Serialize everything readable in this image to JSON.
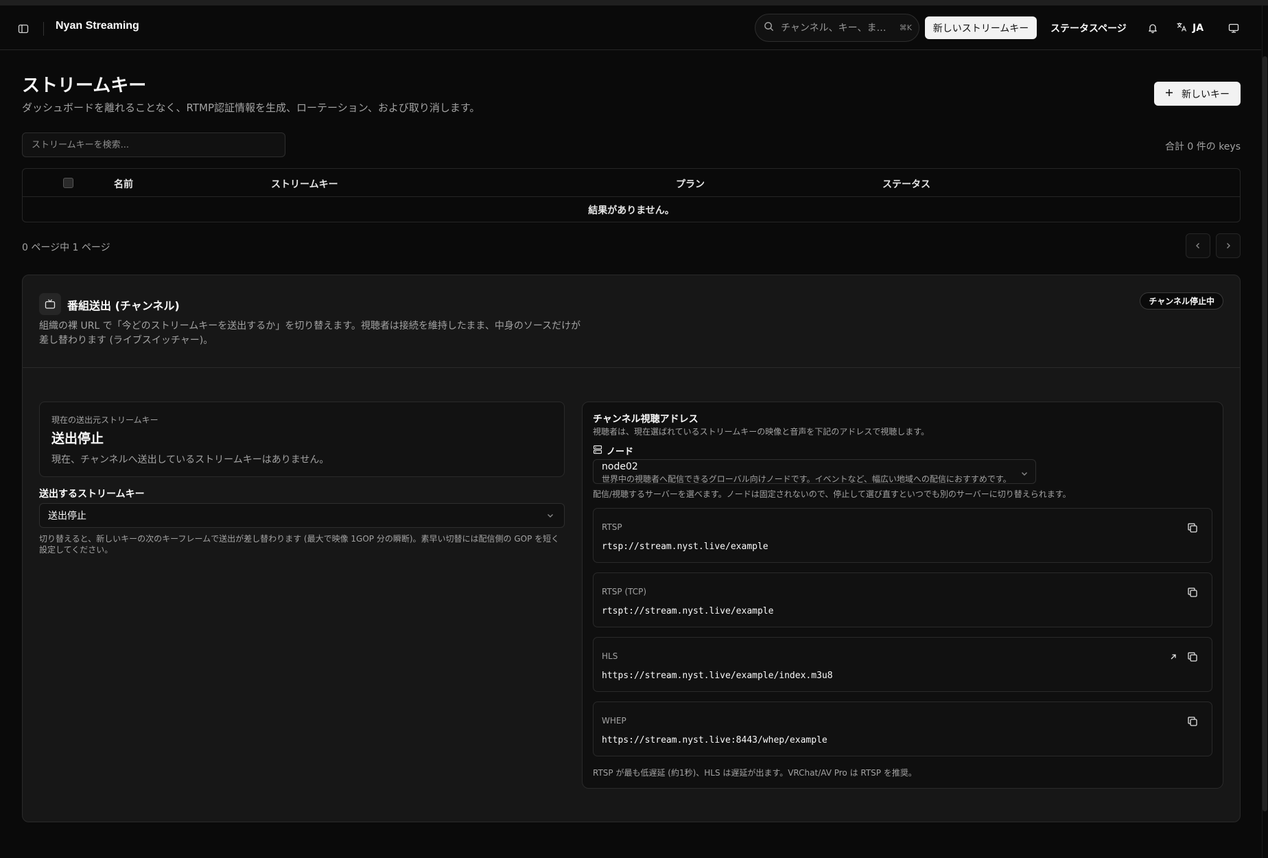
{
  "header": {
    "app_title": "Nyan Streaming",
    "search_placeholder": "チャンネル、キー、ま…",
    "search_shortcut": "⌘K",
    "new_stream_key_label": "新しいストリームキー",
    "status_page_label": "ステータスページ",
    "language_code": "JA"
  },
  "page": {
    "title": "ストリームキー",
    "subtitle": "ダッシュボードを離れることなく、RTMP認証情報を生成、ローテーション、および取り消します。",
    "new_key_label": "新しいキー",
    "search_placeholder": "ストリームキーを検索...",
    "total_count": "合計 0 件の keys"
  },
  "table": {
    "columns": [
      "名前",
      "ストリームキー",
      "プラン",
      "ステータス"
    ],
    "empty_text": "結果がありません。",
    "page_info": "0 ページ中 1 ページ"
  },
  "channel": {
    "title": "番組送出 (チャンネル)",
    "description": "組織の裸 URL で「今どのストリームキーを送出するか」を切り替えます。視聴者は接続を維持したまま、中身のソースだけが差し替わります (ライブスイッチャー)。",
    "status_badge": "チャンネル停止中",
    "current_source": {
      "label": "現在の送出元ストリームキー",
      "value": "送出停止",
      "note": "現在、チャンネルへ送出しているストリームキーはありません。"
    },
    "select": {
      "label": "送出するストリームキー",
      "value": "送出停止",
      "help": "切り替えると、新しいキーの次のキーフレームで送出が差し替わります (最大で映像 1GOP 分の瞬断)。素早い切替には配信側の GOP を短く設定してください。"
    }
  },
  "addresses": {
    "title": "チャンネル視聴アドレス",
    "subtitle": "視聴者は、現在選ばれているストリームキーの映像と音声を下記のアドレスで視聴します。",
    "node_label": "ノード",
    "node_name": "node02",
    "node_desc": "世界中の視聴者へ配信できるグローバル向けノードです。イベントなど、幅広い地域への配信におすすめです。",
    "node_help": "配信/視聴するサーバーを選べます。ノードは固定されないので、停止して選び直すといつでも別のサーバーに切り替えられます。",
    "urls": [
      {
        "protocol": "RTSP",
        "url": "rtsp://stream.nyst.live/example"
      },
      {
        "protocol": "RTSP (TCP)",
        "url": "rtspt://stream.nyst.live/example"
      },
      {
        "protocol": "HLS",
        "url": "https://stream.nyst.live/example/index.m3u8"
      },
      {
        "protocol": "WHEP",
        "url": "https://stream.nyst.live:8443/whep/example"
      }
    ],
    "note": "RTSP が最も低遅延 (約1秒)、HLS は遅延が出ます。VRChat/AV Pro は RTSP を推奨。"
  }
}
